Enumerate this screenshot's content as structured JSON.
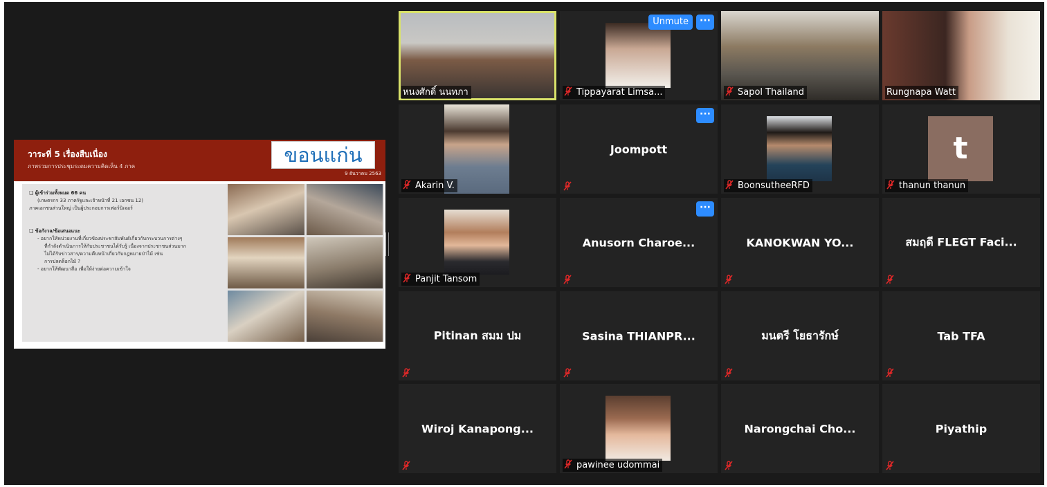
{
  "window": {
    "title": ""
  },
  "shared_slide": {
    "title": "วาระที่ 5 เรื่องสืบเนื่อง",
    "subtitle": "ภาพรวมการประชุมระดมความคิดเห็น 4 ภาค",
    "city": "ขอนแก่น",
    "date": "9 ธันวาคม 2563",
    "lines": [
      {
        "style": "head",
        "text": "❑ ผู้เข้าร่วมทั้งหมด 66 คน"
      },
      {
        "style": "ind",
        "text": "(เกษตรกร 33 ภาครัฐและเจ้าหน้าที่ 21 เอกชน 12)"
      },
      {
        "style": "",
        "text": "ภาคเอกชนส่วนใหญ่ เป็นผู้ประกอบการเฟอร์นิเจอร์"
      },
      {
        "style": "gap",
        "text": ""
      },
      {
        "style": "head",
        "text": "❑ ข้อกังวล/ข้อเสนอแนะ"
      },
      {
        "style": "ind",
        "text": "- อยากให้หน่วยงานที่เกี่ยวข้องประชาสัมพันธ์เกี่ยวกับกระบวนการต่างๆ"
      },
      {
        "style": "ind2",
        "text": "ที่กำลังดำเนินการให้กับประชาชนได้รับรู้ เนื่องจากประชาชนส่วนมาก"
      },
      {
        "style": "ind2",
        "text": "ไม่ได้รับข่าวสาร/ความคืบหน้าเกี่ยวกับกฎหมายป่าไม้ เช่น"
      },
      {
        "style": "ind2",
        "text": "การปลดล็อกไม้ ?"
      },
      {
        "style": "ind",
        "text": "- อยากให้พัฒนาสื่อ เพื่อให้ง่ายต่อความเข้าใจ"
      }
    ]
  },
  "participants": [
    {
      "name": "หนงศักดิ์ นนทภา",
      "display": "video",
      "muted": false,
      "active": true
    },
    {
      "name": "Tippayarat Limsa...",
      "display": "video",
      "muted": true,
      "unmute_label": "Unmute",
      "more": true
    },
    {
      "name": "Sapol  Thailand",
      "display": "video",
      "muted": true
    },
    {
      "name": "Rungnapa Watt",
      "display": "video",
      "muted": false
    },
    {
      "name": "Akarin V.",
      "display": "video",
      "muted": true
    },
    {
      "name": "Joompott",
      "display": "name",
      "muted": true,
      "more": true
    },
    {
      "name": "BoonsutheeRFD",
      "display": "video",
      "muted": true
    },
    {
      "name": "thanun thanun",
      "display": "avatar",
      "avatar_letter": "t",
      "muted": true
    },
    {
      "name": "Panjit Tansom",
      "display": "video",
      "muted": true
    },
    {
      "name": "Anusorn  Charoe...",
      "display": "name",
      "muted": true,
      "more": true
    },
    {
      "name": "KANOKWAN  YO...",
      "display": "name",
      "muted": true
    },
    {
      "name": "สมฤดี FLEGT Faci...",
      "display": "name",
      "muted": true
    },
    {
      "name": "Pitinan สมม ปม",
      "display": "name",
      "muted": true
    },
    {
      "name": "Sasina  THIANPR...",
      "display": "name",
      "muted": true
    },
    {
      "name": "มนตรี  โยธารักษ์",
      "display": "name",
      "muted": true
    },
    {
      "name": "Tab TFA",
      "display": "name",
      "muted": true
    },
    {
      "name": "Wiroj  Kanapong...",
      "display": "name",
      "muted": true
    },
    {
      "name": "pawinee udommai",
      "display": "video",
      "muted": true
    },
    {
      "name": "Narongchai  Cho...",
      "display": "name",
      "muted": true
    },
    {
      "name": "Piyathip",
      "display": "name",
      "muted": true
    }
  ],
  "colors": {
    "app_bg": "#1a1a1a",
    "tile_bg": "#232323",
    "active_speaker": "#d9e26a",
    "button_blue": "#2d8cff",
    "mute_red": "#e02828",
    "slide_header": "#8e1f0e"
  },
  "icons": {
    "muted": "mic-muted-icon",
    "more": "more-options-icon"
  }
}
